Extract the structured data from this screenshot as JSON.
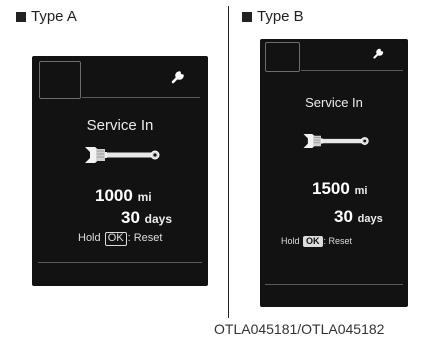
{
  "panels": [
    {
      "heading": "Type A",
      "service_label": "Service In",
      "distance_value": "1000",
      "distance_unit": "mi",
      "days_value": "30",
      "days_unit": "days",
      "hold_prefix": "Hold",
      "ok_label": "OK",
      "hold_suffix": ": Reset"
    },
    {
      "heading": "Type B",
      "service_label": "Service In",
      "distance_value": "1500",
      "distance_unit": "mi",
      "days_value": "30",
      "days_unit": "days",
      "hold_prefix": "Hold",
      "ok_label": "OK",
      "hold_suffix": ": Reset"
    }
  ],
  "caption": "OTLA045181/OTLA045182",
  "colors": {
    "screen_bg": "#121212",
    "text": "#ececec",
    "outline": "#6d6d6d"
  },
  "icons": [
    "wrench-icon",
    "wrench-illustration"
  ]
}
